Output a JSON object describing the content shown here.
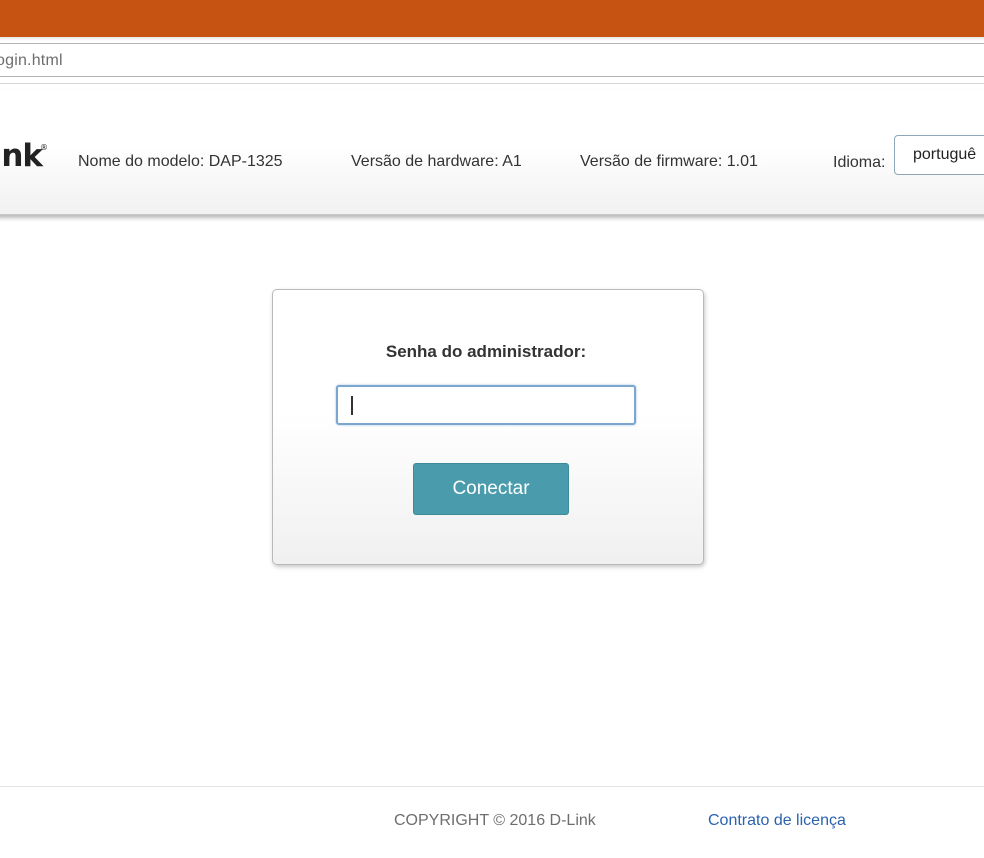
{
  "browser": {
    "url_fragment": "ogin.html",
    "accent_color": "#c75312"
  },
  "header": {
    "logo_text": "nk",
    "logo_mark": "®",
    "model": "Nome do modelo: DAP-1325",
    "hardware": "Versão de hardware: A1",
    "firmware": "Versão de firmware: 1.01",
    "language_label": "Idioma:",
    "language_value": "portuguê"
  },
  "login": {
    "password_label": "Senha do administrador:",
    "password_value": "",
    "connect_label": "Conectar",
    "button_color": "#4a9bac"
  },
  "footer": {
    "copyright": "COPYRIGHT © 2016 D-Link",
    "license_link": "Contrato de licença"
  }
}
